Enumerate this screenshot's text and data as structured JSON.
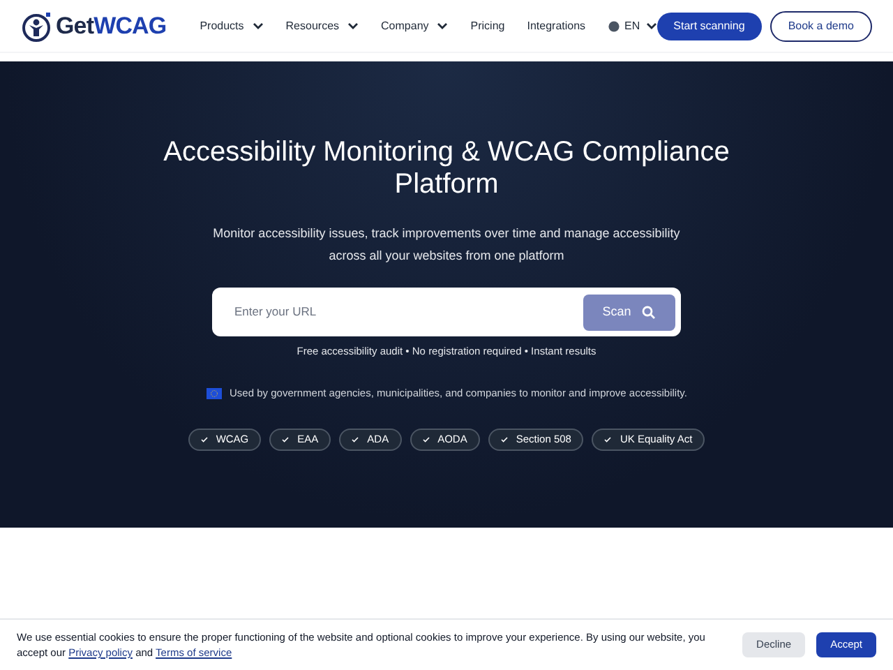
{
  "header": {
    "logo": {
      "part_1": "Get",
      "part_2": "WCAG"
    },
    "nav": [
      {
        "label": "Products",
        "kind": "dropdown"
      },
      {
        "label": "Resources",
        "kind": "dropdown"
      },
      {
        "label": "Company",
        "kind": "dropdown"
      },
      {
        "label": "Pricing",
        "kind": "link"
      },
      {
        "label": "Integrations",
        "kind": "link"
      }
    ],
    "language": "EN",
    "primary_button": "Start scanning",
    "secondary_button": "Book a demo"
  },
  "hero": {
    "title": "Accessibility Monitoring & WCAG Compliance Platform",
    "subtitle": "Monitor accessibility issues, track improvements over time and manage accessibility across all your websites from one platform",
    "url_field": {
      "placeholder": "Enter your URL"
    },
    "scan_button": "Scan",
    "note": "Free accessibility audit • No registration required • Instant results",
    "trust": "Used by government agencies, municipalities, and companies to monitor and improve accessibility.",
    "badges": [
      "WCAG",
      "EAA",
      "ADA",
      "AODA",
      "Section 508",
      "UK Equality Act"
    ]
  },
  "cookie_banner": {
    "text": "We use essential cookies to ensure the proper functioning of the website and optional cookies to improve your experience. By using our website, you accept our",
    "privacy_link": "Privacy policy",
    "joiner": "and",
    "terms_link": "Terms of service",
    "decline": "Decline",
    "accept": "Accept"
  }
}
